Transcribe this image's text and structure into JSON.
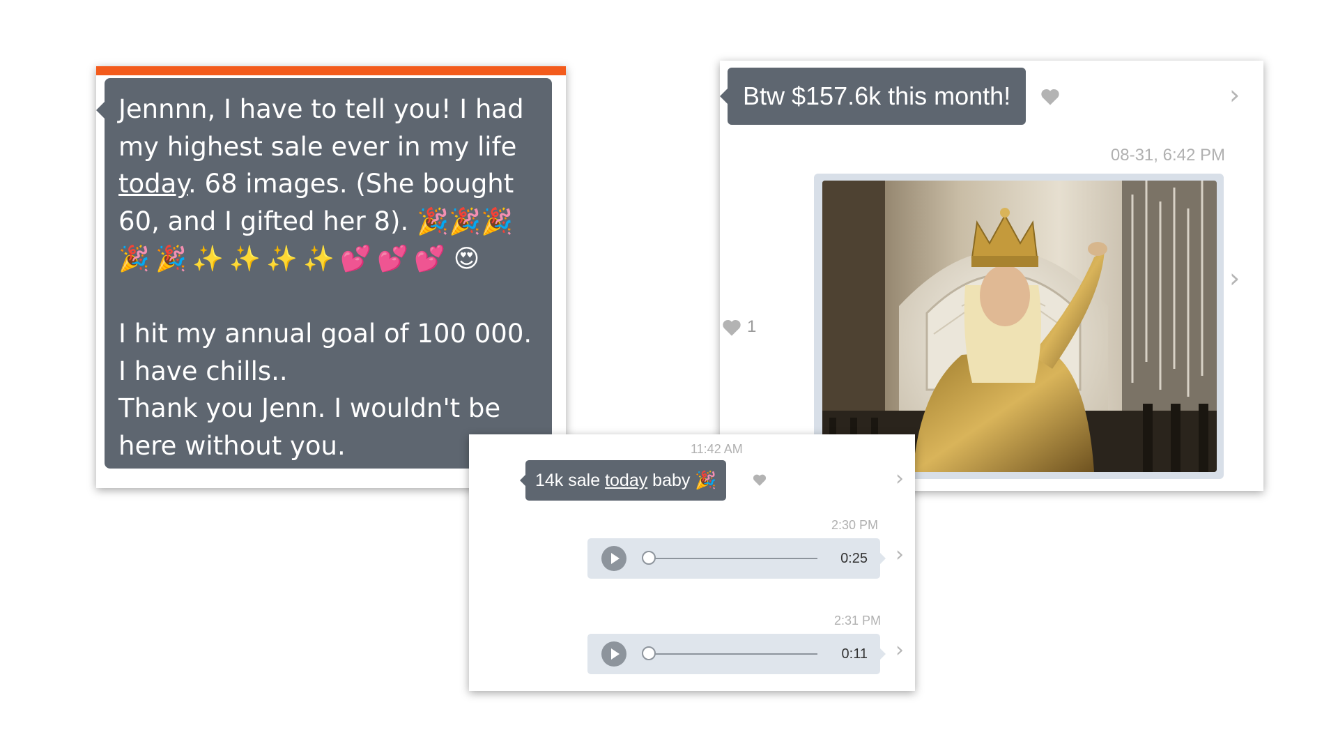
{
  "colors": {
    "accent_bar": "#f35b1c",
    "bubble": "#5e6670",
    "audio_bubble": "#dfe5ec",
    "timestamp": "#b0b0b0"
  },
  "card1": {
    "lines": [
      "Jennnn, I have to tell you! I had",
      "my highest sale ever in my life"
    ],
    "underlined_word": "today",
    "line3_rest": ". 68 images. (She bought",
    "line4": "60, and I gifted her 8).",
    "line4_emojis": "🎉🎉🎉",
    "line5_emojis": [
      "🎉",
      "🎉",
      "✨",
      "✨",
      "✨",
      "✨",
      "💕",
      "💕",
      "💕",
      "😍"
    ],
    "lines_after": [
      "I hit my annual goal of 100 000.",
      "I have chills..",
      "Thank you Jenn. I wouldn't be",
      "here without you."
    ]
  },
  "card2": {
    "message": "Btw $157.6k this month!",
    "timestamp": "08-31, 6:42 PM",
    "like_count": "1",
    "icons": [
      "heart-icon",
      "chevron-right-icon"
    ]
  },
  "card3": {
    "timestamp_1": "11:42 AM",
    "message_before": "14k sale ",
    "message_underlined": "today",
    "message_after": " baby 🎉",
    "timestamp_2": "2:30 PM",
    "audio_1_duration": "0:25",
    "timestamp_3": "2:31 PM",
    "audio_2_duration": "0:11",
    "icons": [
      "heart-icon",
      "chevron-right-icon",
      "play-icon"
    ]
  }
}
